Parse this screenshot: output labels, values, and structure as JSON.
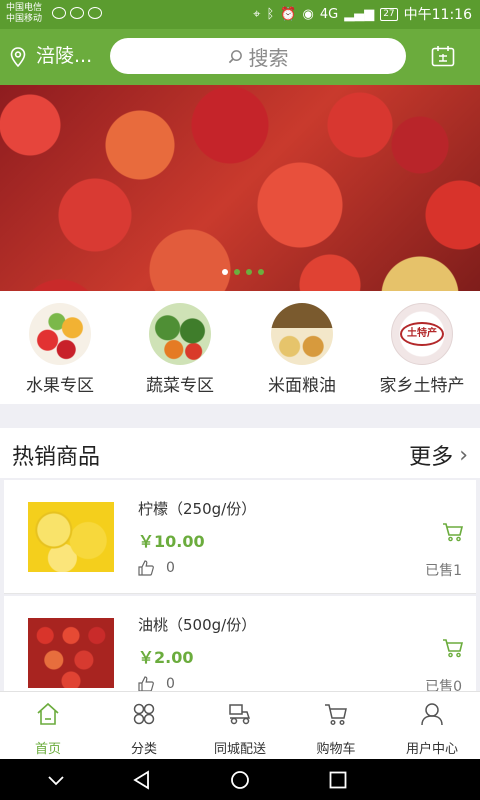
{
  "status_bar": {
    "carrier1": "中国电信",
    "carrier2": "中国移动",
    "battery": "27",
    "time": "中午11:16",
    "network": "4G"
  },
  "header": {
    "location": "涪陵...",
    "search_placeholder": "搜索"
  },
  "banner": {
    "dots": 4,
    "active_dot": 1
  },
  "categories": [
    {
      "label": "水果专区",
      "icon": "fruit-image"
    },
    {
      "label": "蔬菜专区",
      "icon": "vegetable-image"
    },
    {
      "label": "米面粮油",
      "icon": "grain-oil-image"
    },
    {
      "label": "家乡土特产",
      "icon": "local-specialty-image"
    }
  ],
  "local_badge": "土特产",
  "hot": {
    "title": "热销商品",
    "more": "更多"
  },
  "products": [
    {
      "name": "柠檬（250g/份）",
      "price": "￥10.00",
      "likes": "0",
      "sold": "已售1"
    },
    {
      "name": "油桃（500g/份）",
      "price": "￥2.00",
      "likes": "0",
      "sold": "已售0"
    }
  ],
  "nav": [
    {
      "label": "首页",
      "icon": "home-icon",
      "active": true
    },
    {
      "label": "分类",
      "icon": "category-icon"
    },
    {
      "label": "同城配送",
      "icon": "delivery-icon"
    },
    {
      "label": "购物车",
      "icon": "cart-icon"
    },
    {
      "label": "用户中心",
      "icon": "user-icon"
    }
  ],
  "colors": {
    "accent": "#6bac3d",
    "status_bar": "#5b9c2f"
  }
}
